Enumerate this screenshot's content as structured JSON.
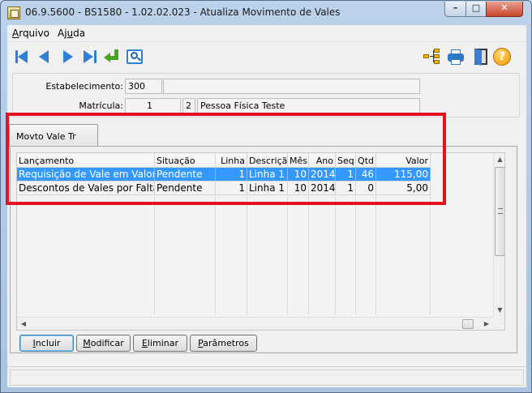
{
  "window": {
    "title": "06.9.5600 - BS1580 - 1.02.02.023 - Atualiza Movimento de Vales",
    "min": "–",
    "max": "□",
    "close": "✕"
  },
  "menu": {
    "arquivo_first": "A",
    "arquivo_rest": "rquivo",
    "ajuda_first": "Aj",
    "ajuda_u": "u",
    "ajuda_rest": "da"
  },
  "toolbar": {
    "icons": [
      "first-record-icon",
      "previous-record-icon",
      "next-record-icon",
      "last-record-icon",
      "enter-icon",
      "search-icon",
      "hierarchy-icon",
      "printer-icon",
      "exit-door-icon",
      "help-icon"
    ],
    "help_glyph": "?"
  },
  "header": {
    "estabelecimento_label": "Estabelecimento:",
    "estabelecimento_code": "300",
    "estabelecimento_desc": "",
    "matricula_label": "Matrícula:",
    "matricula_number": "1",
    "matricula_digit": "2",
    "matricula_name": "Pessoa Física Teste"
  },
  "tab": {
    "label": "Movto Vale Tr"
  },
  "grid": {
    "columns": [
      "Lançamento",
      "Situação",
      "Linha",
      "Descrição",
      "Mês",
      "Ano",
      "Seq",
      "Qtd",
      "Valor"
    ],
    "rows": [
      [
        "Requisição de Vale em Valor",
        "Pendente",
        "1",
        "Linha 1",
        "10",
        "2014",
        "1",
        "46",
        "115,00"
      ],
      [
        "Descontos de Vales por Falta",
        "Pendente",
        "1",
        "Linha 1",
        "10",
        "2014",
        "1",
        "0",
        "5,00"
      ]
    ],
    "selected_row": 0
  },
  "buttons": {
    "incluir_u": "I",
    "incluir_rest": "ncluir",
    "modificar_u": "M",
    "modificar_rest": "odificar",
    "eliminar_u": "E",
    "eliminar_rest": "liminar",
    "parametros_u": "P",
    "parametros_rest": "arâmetros"
  },
  "colors": {
    "selection": "#3399ff",
    "highlight_border": "#e3121f",
    "accent_blue": "#2e7fd6"
  }
}
